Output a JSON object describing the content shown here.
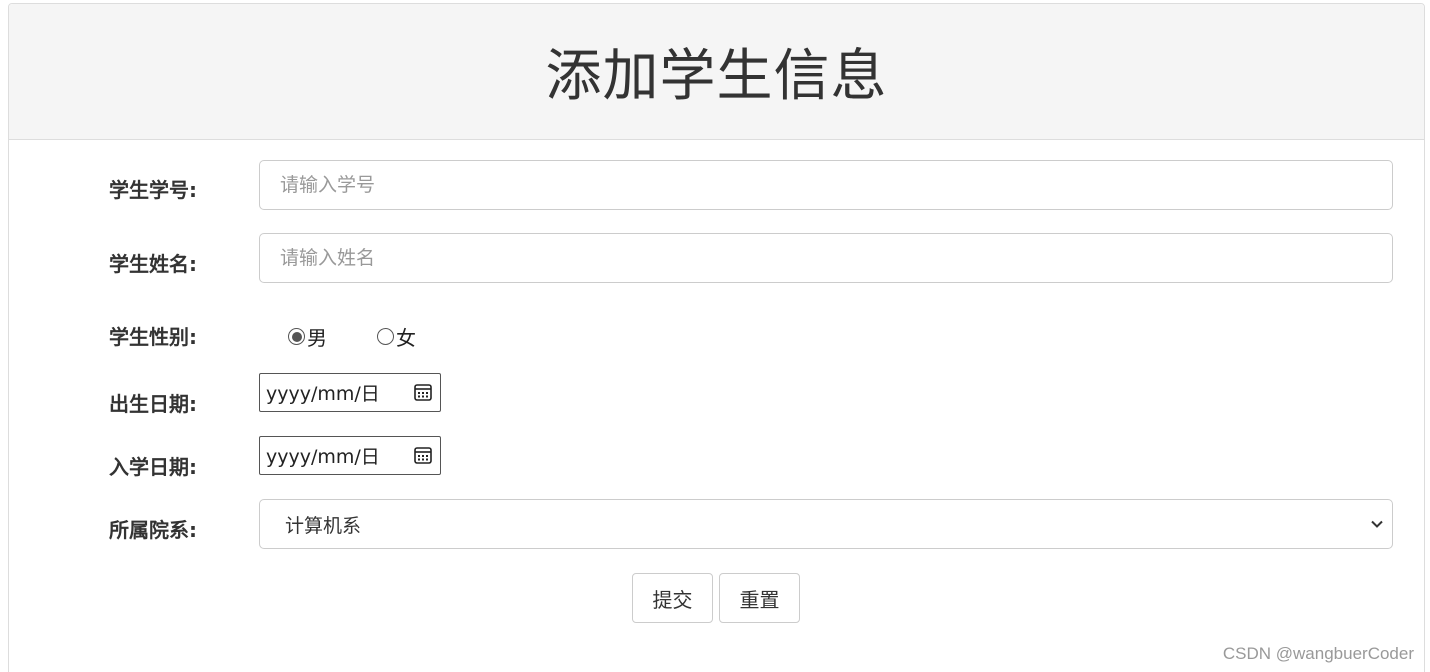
{
  "header": {
    "title": "添加学生信息"
  },
  "form": {
    "student_id": {
      "label": "学生学号:",
      "placeholder": "请输入学号",
      "value": ""
    },
    "student_name": {
      "label": "学生姓名:",
      "placeholder": "请输入姓名",
      "value": ""
    },
    "gender": {
      "label": "学生性别:",
      "options": [
        {
          "label": "男",
          "checked": true
        },
        {
          "label": "女",
          "checked": false
        }
      ]
    },
    "birth_date": {
      "label": "出生日期:",
      "display": "yyyy/mm/日"
    },
    "enroll_date": {
      "label": "入学日期:",
      "display": "yyyy/mm/日"
    },
    "department": {
      "label": "所属院系:",
      "selected": "计算机系"
    }
  },
  "buttons": {
    "submit_label": "提交",
    "reset_label": "重置"
  },
  "watermark": "CSDN @wangbuerCoder",
  "colors": {
    "heading_bg": "#f5f5f5",
    "border": "#cccccc",
    "text": "#333333",
    "placeholder": "#999999"
  },
  "icons": {
    "date_picker": "calendar-icon",
    "select_arrow": "chevron-down-icon"
  }
}
